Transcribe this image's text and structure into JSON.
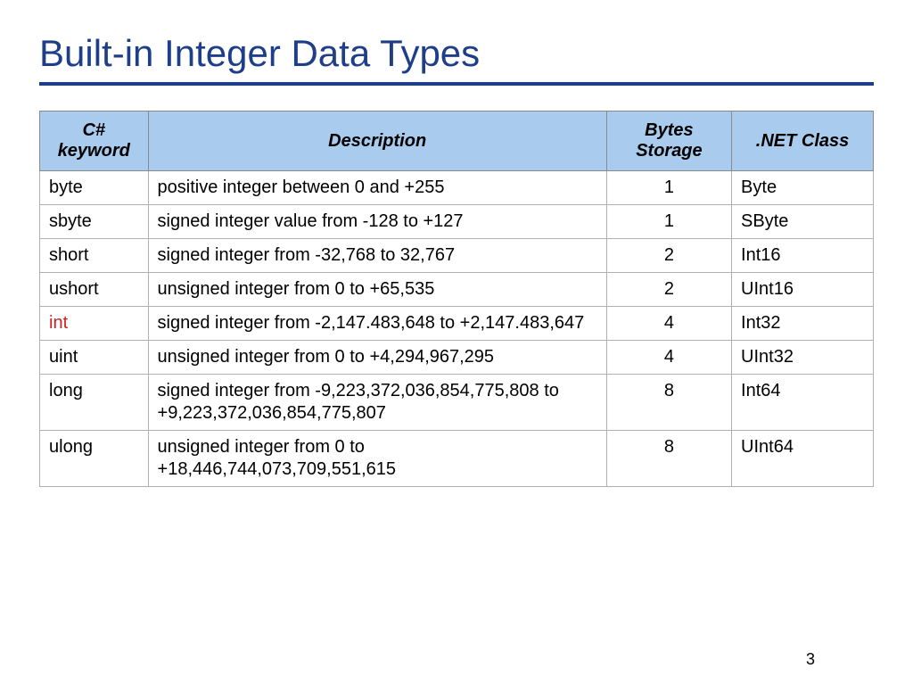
{
  "title": "Built-in Integer Data Types",
  "page_number": "3",
  "table": {
    "headers": {
      "keyword": "C# keyword",
      "description": "Description",
      "bytes": "Bytes Storage",
      "net": ".NET Class"
    },
    "rows": [
      {
        "keyword": "byte",
        "highlight": false,
        "description": "positive integer between 0 and +255",
        "bytes": "1",
        "net": "Byte"
      },
      {
        "keyword": "sbyte",
        "highlight": false,
        "description": "signed integer value from -128 to +127",
        "bytes": "1",
        "net": "SByte"
      },
      {
        "keyword": "short",
        "highlight": false,
        "description": "signed integer from -32,768 to 32,767",
        "bytes": "2",
        "net": "Int16"
      },
      {
        "keyword": "ushort",
        "highlight": false,
        "description": "unsigned integer from 0 to +65,535",
        "bytes": "2",
        "net": "UInt16"
      },
      {
        "keyword": "int",
        "highlight": true,
        "description": "signed integer from -2,147.483,648 to +2,147.483,647",
        "bytes": "4",
        "net": "Int32"
      },
      {
        "keyword": "uint",
        "highlight": false,
        "description": "unsigned integer from 0 to +4,294,967,295",
        "bytes": "4",
        "net": "UInt32"
      },
      {
        "keyword": "long",
        "highlight": false,
        "description": "signed integer from -9,223,372,036,854,775,808 to +9,223,372,036,854,775,807",
        "bytes": "8",
        "net": "Int64"
      },
      {
        "keyword": "ulong",
        "highlight": false,
        "description": "unsigned integer from 0 to +18,446,744,073,709,551,615",
        "bytes": "8",
        "net": "UInt64"
      }
    ]
  }
}
